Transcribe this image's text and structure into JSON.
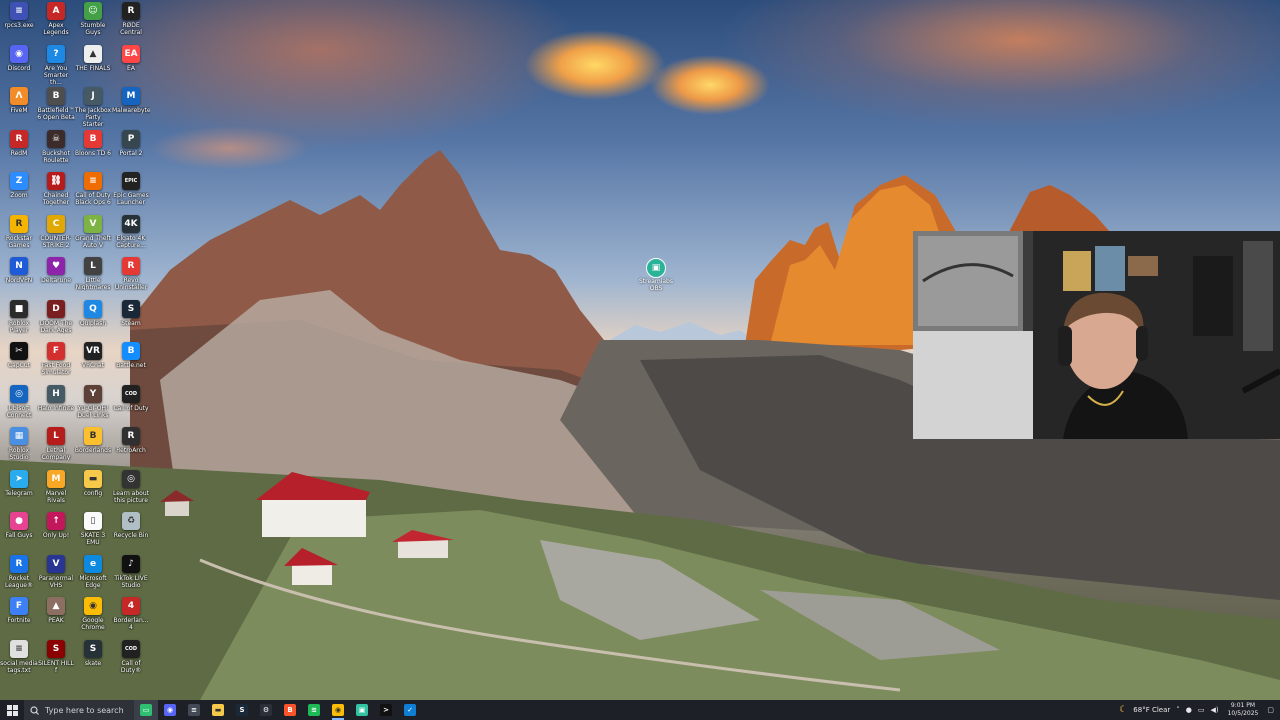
{
  "desktop": {
    "icons": [
      {
        "label": "rpcs3.exe",
        "icon": "rpcs3-icon",
        "color": "#3f51b5",
        "glyph": "≡"
      },
      {
        "label": "Discord",
        "icon": "discord-icon",
        "color": "#5865f2",
        "glyph": "◉"
      },
      {
        "label": "FiveM",
        "icon": "fivem-icon",
        "color": "#f28c28",
        "glyph": "Λ"
      },
      {
        "label": "RedM",
        "icon": "redm-icon",
        "color": "#c62828",
        "glyph": "R"
      },
      {
        "label": "Zoom",
        "icon": "zoom-icon",
        "color": "#2d8cff",
        "glyph": "Z"
      },
      {
        "label": "Rockstar Games",
        "icon": "rockstar-icon",
        "color": "#f4b400",
        "glyph": "R"
      },
      {
        "label": "NordVPN",
        "icon": "nordvpn-icon",
        "color": "#1f5bd6",
        "glyph": "N"
      },
      {
        "label": "Roblox Player",
        "icon": "roblox-icon",
        "color": "#2b2b2b",
        "glyph": "■"
      },
      {
        "label": "CapCut",
        "icon": "capcut-icon",
        "color": "#111111",
        "glyph": "✂"
      },
      {
        "label": "Ubisoft Connect",
        "icon": "ubisoft-icon",
        "color": "#1665c1",
        "glyph": "◎"
      },
      {
        "label": "Roblox Studio",
        "icon": "roblox-studio-icon",
        "color": "#4a90e2",
        "glyph": "▦"
      },
      {
        "label": "Telegram",
        "icon": "telegram-icon",
        "color": "#2aabee",
        "glyph": "➤"
      },
      {
        "label": "Fall Guys",
        "icon": "fall-guys-icon",
        "color": "#e84393",
        "glyph": "●"
      },
      {
        "label": "Rocket League®",
        "icon": "rocket-league-icon",
        "color": "#1a73e8",
        "glyph": "R"
      },
      {
        "label": "Fortnite",
        "icon": "fortnite-icon",
        "color": "#3d7ff5",
        "glyph": "F"
      },
      {
        "label": "social media tags.txt",
        "icon": "text-file-icon",
        "color": "#e0e0e0",
        "glyph": "≡"
      },
      {
        "label": "Apex Legends",
        "icon": "apex-icon",
        "color": "#c62828",
        "glyph": "A"
      },
      {
        "label": "Are You Smarter th...",
        "icon": "are-you-smarter-icon",
        "color": "#1e88e5",
        "glyph": "?"
      },
      {
        "label": "Battlefield™ 6 Open Beta",
        "icon": "battlefield-icon",
        "color": "#4e4e4e",
        "glyph": "B"
      },
      {
        "label": "Buckshot Roulette",
        "icon": "buckshot-icon",
        "color": "#3b2b2b",
        "glyph": "☠"
      },
      {
        "label": "Chained Together",
        "icon": "chained-together-icon",
        "color": "#b71c1c",
        "glyph": "⛓"
      },
      {
        "label": "COUNTER-STRIKE 2",
        "icon": "cs2-icon",
        "color": "#e0a800",
        "glyph": "C"
      },
      {
        "label": "Deltarune",
        "icon": "deltarune-icon",
        "color": "#8e24aa",
        "glyph": "♥"
      },
      {
        "label": "DOOM The Dark Ages",
        "icon": "doom-icon",
        "color": "#7a1f1f",
        "glyph": "D"
      },
      {
        "label": "Fast Food Simulator",
        "icon": "fast-food-icon",
        "color": "#d32f2f",
        "glyph": "F"
      },
      {
        "label": "Halo Infinite",
        "icon": "halo-icon",
        "color": "#455a64",
        "glyph": "H"
      },
      {
        "label": "Lethal Company",
        "icon": "lethal-company-icon",
        "color": "#b71c1c",
        "glyph": "L"
      },
      {
        "label": "Marvel Rivals",
        "icon": "marvel-rivals-icon",
        "color": "#f9a825",
        "glyph": "M"
      },
      {
        "label": "Only Up!",
        "icon": "only-up-icon",
        "color": "#c2185b",
        "glyph": "↑"
      },
      {
        "label": "Paranormal VHS",
        "icon": "paranormal-vhs-icon",
        "color": "#283593",
        "glyph": "V"
      },
      {
        "label": "PEAK",
        "icon": "peak-icon",
        "color": "#8d6e63",
        "glyph": "▲"
      },
      {
        "label": "SILENT HILL f",
        "icon": "silent-hill-icon",
        "color": "#8b0000",
        "glyph": "S"
      },
      {
        "label": "Stumble Guys",
        "icon": "stumble-guys-icon",
        "color": "#43a047",
        "glyph": "☺"
      },
      {
        "label": "THE FINALS",
        "icon": "the-finals-icon",
        "color": "#eeeeee",
        "glyph": "▲"
      },
      {
        "label": "The Jackbox Party Starter",
        "icon": "jackbox-icon",
        "color": "#455a64",
        "glyph": "J"
      },
      {
        "label": "Bloons TD 6",
        "icon": "bloons-icon",
        "color": "#e53935",
        "glyph": "B"
      },
      {
        "label": "Call of Duty Black Ops 6",
        "icon": "call-of-duty-icon",
        "color": "#ef6c00",
        "glyph": "≡"
      },
      {
        "label": "Grand Theft Auto V",
        "icon": "gta-v-icon",
        "color": "#7cb342",
        "glyph": "V"
      },
      {
        "label": "Little Nightmares",
        "icon": "little-nightmares-icon",
        "color": "#424242",
        "glyph": "L"
      },
      {
        "label": "Quiplash",
        "icon": "quiplash-icon",
        "color": "#1e88e5",
        "glyph": "Q"
      },
      {
        "label": "VRChat",
        "icon": "vrchat-icon",
        "color": "#222222",
        "glyph": "VR"
      },
      {
        "label": "YU-GI-OH! Duel Links",
        "icon": "yugioh-icon",
        "color": "#5d4037",
        "glyph": "Y"
      },
      {
        "label": "Borderlands",
        "icon": "borderlands-icon",
        "color": "#fbc02d",
        "glyph": "B"
      },
      {
        "label": "config",
        "icon": "folder-icon",
        "color": "#f6c94b",
        "glyph": "▬"
      },
      {
        "label": "SKATE 3 EMU",
        "icon": "skate-emu-icon",
        "color": "#fafafa",
        "glyph": "▯"
      },
      {
        "label": "Microsoft Edge",
        "icon": "edge-icon",
        "color": "#0c8ae0",
        "glyph": "e"
      },
      {
        "label": "Google Chrome",
        "icon": "chrome-icon",
        "color": "#fbbc05",
        "glyph": "◉"
      },
      {
        "label": "skate",
        "icon": "skate-icon",
        "color": "#263238",
        "glyph": "S"
      },
      {
        "label": "RØDE Central",
        "icon": "rode-central-icon",
        "color": "#222222",
        "glyph": "R"
      },
      {
        "label": "EA",
        "icon": "ea-icon",
        "color": "#ff4747",
        "glyph": "EA"
      },
      {
        "label": "Malwarebytes",
        "icon": "malwarebytes-icon",
        "color": "#1565c0",
        "glyph": "M"
      },
      {
        "label": "Portal 2",
        "icon": "portal-2-icon",
        "color": "#37474f",
        "glyph": "P"
      },
      {
        "label": "Epic Games Launcher",
        "icon": "epic-games-icon",
        "color": "#222222",
        "glyph": "EPIC"
      },
      {
        "label": "Elgato 4K Capture...",
        "icon": "elgato-icon",
        "color": "#263238",
        "glyph": "4K"
      },
      {
        "label": "Revo Uninstaller",
        "icon": "revo-icon",
        "color": "#e53935",
        "glyph": "R"
      },
      {
        "label": "Steam",
        "icon": "steam-icon",
        "color": "#1b2838",
        "glyph": "S"
      },
      {
        "label": "Battle.net",
        "icon": "battlenet-icon",
        "color": "#148eff",
        "glyph": "B"
      },
      {
        "label": "Call of Duty",
        "icon": "call-of-duty-2-icon",
        "color": "#212121",
        "glyph": "COD"
      },
      {
        "label": "RetroArch",
        "icon": "retroarch-icon",
        "color": "#303030",
        "glyph": "R"
      },
      {
        "label": "Learn about this picture",
        "icon": "learn-picture-icon",
        "color": "#333333",
        "glyph": "◎"
      },
      {
        "label": "Recycle Bin",
        "icon": "recycle-bin-icon",
        "color": "#b0bec5",
        "glyph": "♻"
      },
      {
        "label": "TikTok LIVE Studio",
        "icon": "tiktok-live-icon",
        "color": "#111111",
        "glyph": "♪"
      },
      {
        "label": "Borderlan... 4",
        "icon": "borderlands-4-icon",
        "color": "#c62828",
        "glyph": "4"
      },
      {
        "label": "Call of Duty®",
        "icon": "call-of-duty-3-icon",
        "color": "#212121",
        "glyph": "COD"
      }
    ],
    "center_icon": {
      "label": "Streamlabs OBS",
      "icon": "streamlabs-icon"
    }
  },
  "taskbar": {
    "search_placeholder": "Type here to search",
    "apps": [
      {
        "name": "file-manager",
        "icon": "task-view-icon",
        "color": "#2fbf71",
        "glyph": "▭",
        "focused": true
      },
      {
        "name": "discord",
        "icon": "discord-taskbar-icon",
        "color": "#5865f2",
        "glyph": "◉"
      },
      {
        "name": "notes",
        "icon": "notes-icon",
        "color": "#444a55",
        "glyph": "≡"
      },
      {
        "name": "file-explorer",
        "icon": "file-explorer-icon",
        "color": "#f6c94b",
        "glyph": "▬"
      },
      {
        "name": "steam",
        "icon": "steam-taskbar-icon",
        "color": "#1b2838",
        "glyph": "S"
      },
      {
        "name": "settings",
        "icon": "settings-icon",
        "color": "#2b2f37",
        "glyph": "⚙"
      },
      {
        "name": "brave",
        "icon": "brave-icon",
        "color": "#fb542b",
        "glyph": "B"
      },
      {
        "name": "spotify",
        "icon": "spotify-icon",
        "color": "#1db954",
        "glyph": "≋"
      },
      {
        "name": "chrome",
        "icon": "chrome-taskbar-icon",
        "color": "#fbbc05",
        "glyph": "◉",
        "active": true
      },
      {
        "name": "streamlabs",
        "icon": "streamlabs-taskbar-icon",
        "color": "#31c3a2",
        "glyph": "▣"
      },
      {
        "name": "terminal",
        "icon": "terminal-icon",
        "color": "#111111",
        "glyph": ">"
      },
      {
        "name": "vscode",
        "icon": "vscode-icon",
        "color": "#0e7fd4",
        "glyph": "✓"
      }
    ],
    "weather": "68°F  Clear",
    "time": "9:01 PM",
    "date": "10/5/2025"
  }
}
